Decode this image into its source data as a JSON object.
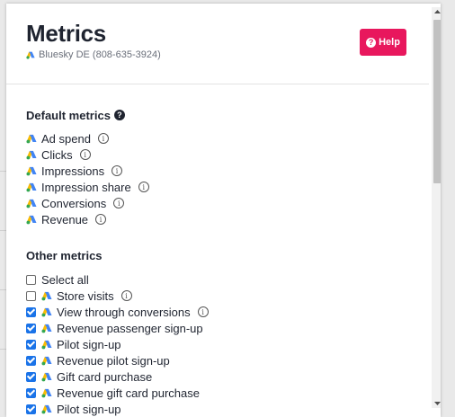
{
  "modal": {
    "title": "Metrics",
    "account": "Bluesky DE (808-635-3924)",
    "help_label": "Help",
    "help_icon_glyph": "?",
    "accent_color": "#e8175d"
  },
  "default_metrics": {
    "title": "Default metrics",
    "title_icon_glyph": "?",
    "items": [
      {
        "label": "Ad spend"
      },
      {
        "label": "Clicks"
      },
      {
        "label": "Impressions"
      },
      {
        "label": "Impression share"
      },
      {
        "label": "Conversions"
      },
      {
        "label": "Revenue"
      }
    ]
  },
  "other_metrics": {
    "title": "Other metrics",
    "items": [
      {
        "label": "Select all",
        "checked": false,
        "gads": false,
        "info": false
      },
      {
        "label": "Store visits",
        "checked": false,
        "gads": true,
        "info": true
      },
      {
        "label": "View through conversions",
        "checked": true,
        "gads": true,
        "info": true
      },
      {
        "label": "Revenue passenger sign-up",
        "checked": true,
        "gads": true,
        "info": false
      },
      {
        "label": "Pilot sign-up",
        "checked": true,
        "gads": true,
        "info": false
      },
      {
        "label": "Revenue pilot sign-up",
        "checked": true,
        "gads": true,
        "info": false
      },
      {
        "label": "Gift card purchase",
        "checked": true,
        "gads": true,
        "info": false
      },
      {
        "label": "Revenue gift card purchase",
        "checked": true,
        "gads": true,
        "info": false
      },
      {
        "label": "Pilot sign-up",
        "checked": true,
        "gads": true,
        "info": false
      }
    ]
  },
  "info_glyph": "i"
}
